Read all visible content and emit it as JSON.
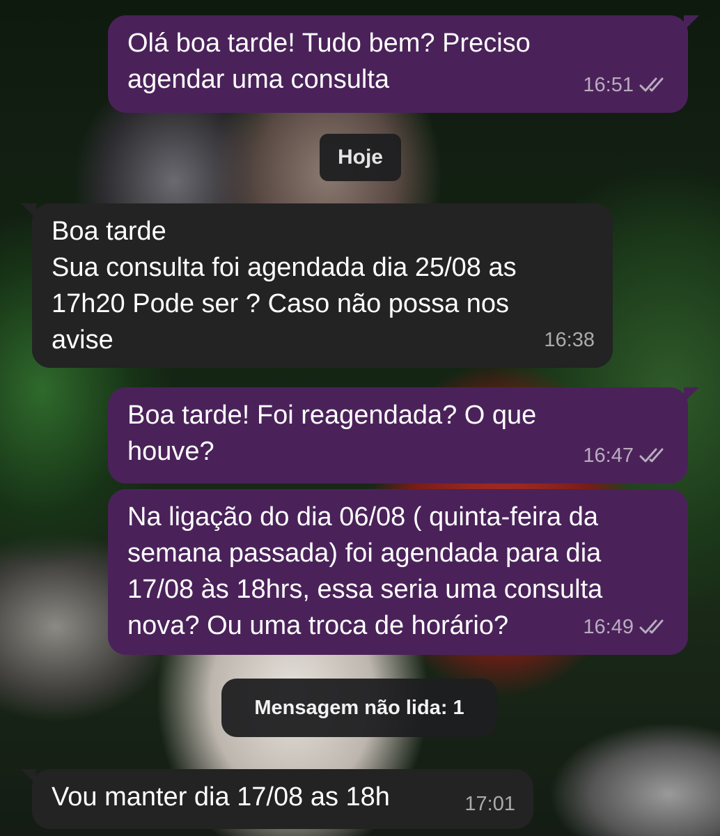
{
  "chat": {
    "messages": [
      {
        "direction": "out",
        "text": "Olá boa tarde! Tudo bem? Preciso\nagendar uma consulta",
        "time": "16:51",
        "status_icon": "double-check-icon"
      },
      {
        "direction": "in",
        "text": "Boa tarde\nSua consulta foi agendada dia 25/08 as\n17h20 Pode ser ? Caso não possa nos\navise",
        "time": "16:38"
      },
      {
        "direction": "out",
        "text": "Boa tarde! Foi reagendada? O que\nhouve?",
        "time": "16:47",
        "status_icon": "double-check-icon"
      },
      {
        "direction": "out",
        "text": "Na ligação do dia 06/08 ( quinta-feira da\nsemana passada) foi agendada para dia\n17/08 às 18hrs, essa seria uma consulta\nnova? Ou uma troca de horário?",
        "time": "16:49",
        "status_icon": "double-check-icon"
      },
      {
        "direction": "in",
        "text": "Vou manter dia 17/08 as 18h",
        "time": "17:01"
      }
    ],
    "date_separator": "Hoje",
    "unread_separator": "Mensagem não lida: 1"
  },
  "colors": {
    "outgoing_bubble": "#4a2259",
    "incoming_bubble": "#232323",
    "separator_pill": "#1e1e20"
  }
}
